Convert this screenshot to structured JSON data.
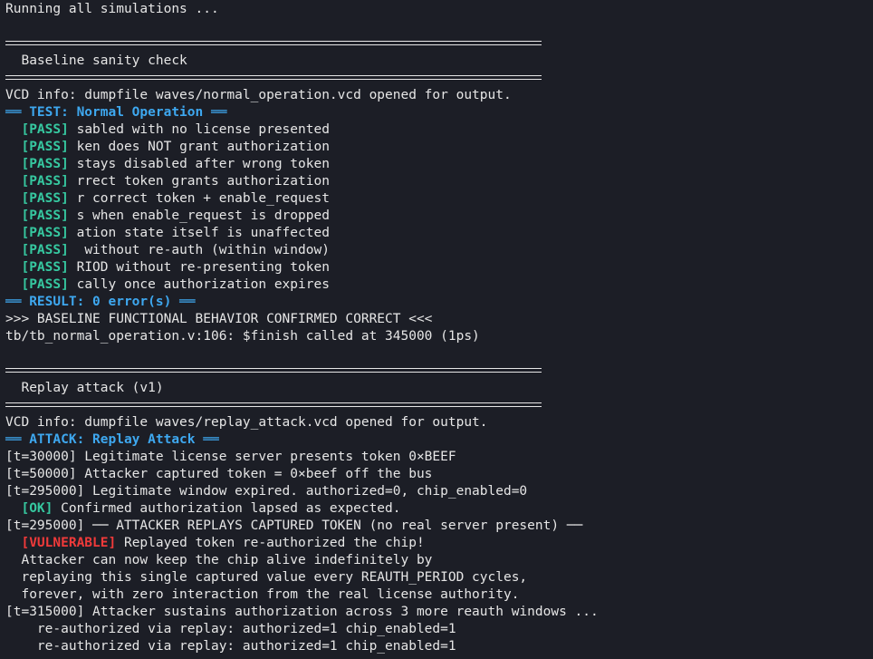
{
  "colors": {
    "background": "#1c1e26",
    "text": "#e6e6e6",
    "header_blue": "#3ea8f0",
    "pass_green": "#36c8a0",
    "vulnerable_red": "#f03a3a"
  },
  "terminal": {
    "running": "Running all simulations ...",
    "baseline_title": "  Baseline sanity check",
    "baseline_vcd": "VCD info: dumpfile waves/normal_operation.vcd opened for output.",
    "test_header": "══ TEST: Normal Operation ══",
    "pass_tag": "[PASS]",
    "pass_lines": [
      " sabled with no license presented",
      " ken does NOT grant authorization",
      " stays disabled after wrong token",
      " rrect token grants authorization",
      " r correct token + enable_request",
      " s when enable_request is dropped",
      " ation state itself is unaffected",
      "  without re-auth (within window)",
      " RIOD without re-presenting token",
      " cally once authorization expires"
    ],
    "result_header": "══ RESULT: 0 error(s) ══",
    "baseline_confirmed": ">>> BASELINE FUNCTIONAL BEHAVIOR CONFIRMED CORRECT <<<",
    "finish": "tb/tb_normal_operation.v:106: $finish called at 345000 (1ps)",
    "replay_title": "  Replay attack (v1)",
    "replay_vcd": "VCD info: dumpfile waves/replay_attack.vcd opened for output.",
    "attack_header": "══ ATTACK: Replay Attack ══",
    "log_1": "[t=30000] Legitimate license server presents token 0×BEEF",
    "log_2": "[t=50000] Attacker captured token = 0×beef off the bus",
    "log_3": "[t=295000] Legitimate window expired. authorized=0, chip_enabled=0",
    "ok_tag": "[OK]",
    "ok_text": " Confirmed authorization lapsed as expected.",
    "log_4": "[t=295000] ── ATTACKER REPLAYS CAPTURED TOKEN (no real server present) ──",
    "vuln_tag": "[VULNERABLE]",
    "vuln_text": " Replayed token re-authorized the chip!",
    "detail_1": "  Attacker can now keep the chip alive indefinitely by",
    "detail_2": "  replaying this single captured value every REAUTH_PERIOD cycles,",
    "detail_3": "  forever, with zero interaction from the real license authority.",
    "log_5": "[t=315000] Attacker sustains authorization across 3 more reauth windows ...",
    "reauth_1": "    re-authorized via replay: authorized=1 chip_enabled=1",
    "reauth_2": "    re-authorized via replay: authorized=1 chip_enabled=1"
  }
}
